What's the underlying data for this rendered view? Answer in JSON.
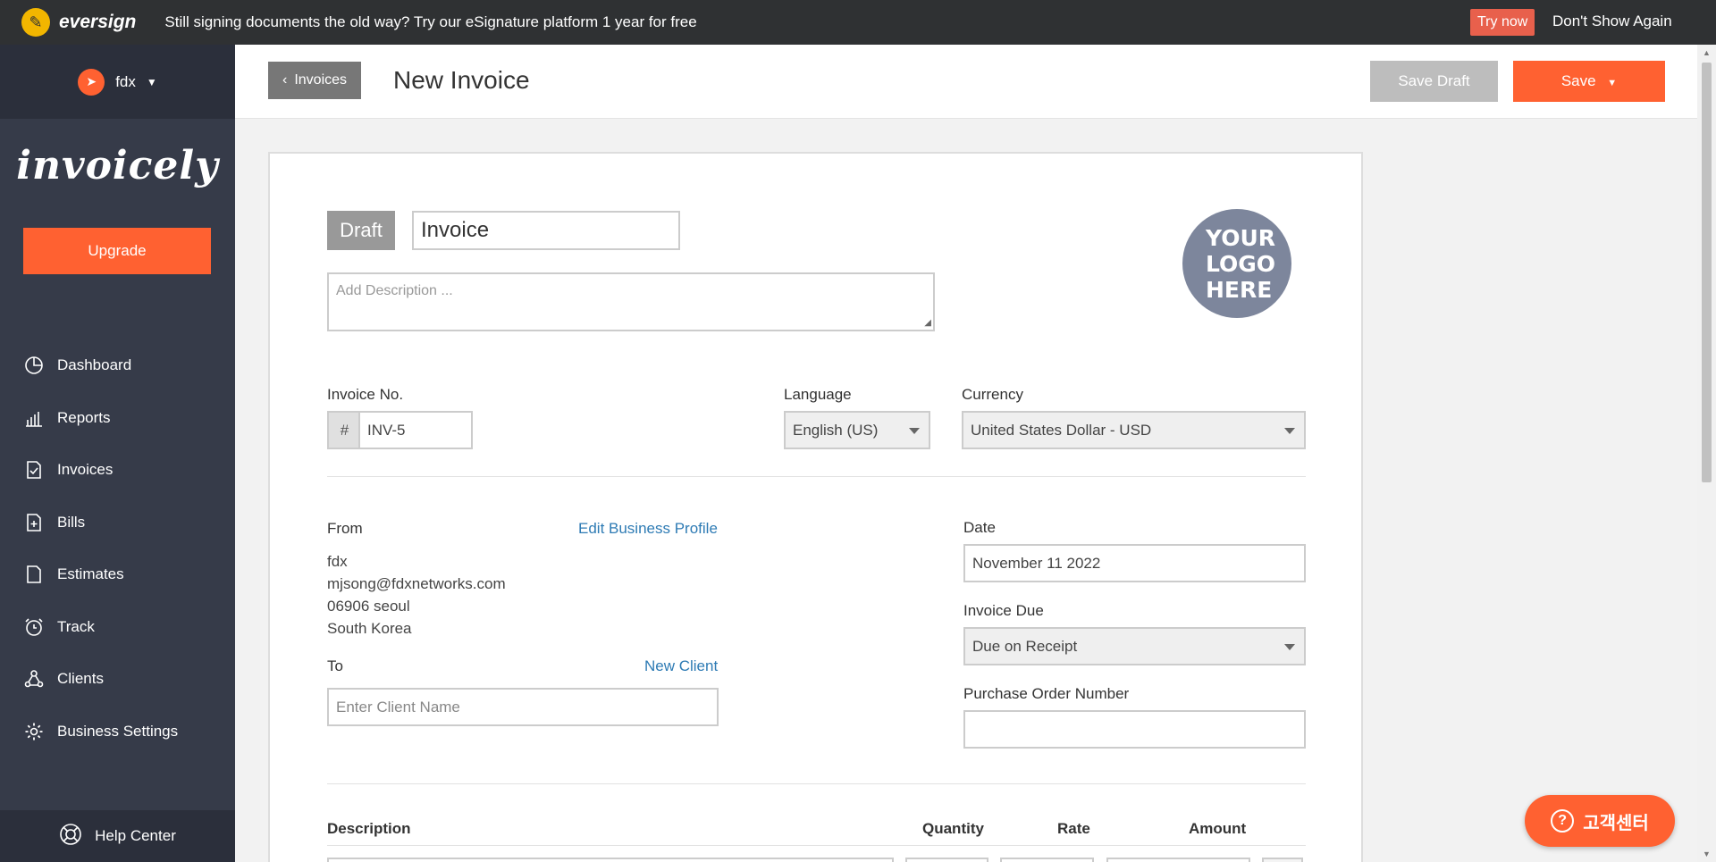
{
  "banner": {
    "brand": "eversign",
    "promo": "Still signing documents the old way? Try our eSignature platform 1 year for free",
    "try_now": "Try now",
    "dont_show": "Don't Show Again",
    "accent": "#e8604c"
  },
  "sidebar": {
    "account_name": "fdx",
    "brand": "invoicely",
    "upgrade": "Upgrade",
    "items": [
      {
        "label": "Dashboard",
        "icon": "pie-chart-icon"
      },
      {
        "label": "Reports",
        "icon": "bar-chart-icon"
      },
      {
        "label": "Invoices",
        "icon": "invoice-doc-icon"
      },
      {
        "label": "Bills",
        "icon": "bill-plus-icon"
      },
      {
        "label": "Estimates",
        "icon": "document-icon"
      },
      {
        "label": "Track",
        "icon": "alarm-clock-icon"
      },
      {
        "label": "Clients",
        "icon": "clients-icon"
      },
      {
        "label": "Business Settings",
        "icon": "gear-icon"
      }
    ],
    "help": "Help Center"
  },
  "header": {
    "back": "Invoices",
    "title": "New Invoice",
    "save_draft": "Save Draft",
    "save": "Save",
    "accent": "#ff6131"
  },
  "invoice": {
    "status": "Draft",
    "title_value": "Invoice",
    "description_placeholder": "Add Description ...",
    "logo_text": "YOUR LOGO HERE",
    "invoice_no_label": "Invoice No.",
    "hash": "#",
    "invoice_no": "INV-5",
    "language_label": "Language",
    "language": "English (US)",
    "currency_label": "Currency",
    "currency": "United States Dollar - USD",
    "from_label": "From",
    "edit_profile": "Edit Business Profile",
    "from_lines": [
      "fdx",
      "mjsong@fdxnetworks.com",
      "06906 seoul",
      "South Korea"
    ],
    "to_label": "To",
    "new_client": "New Client",
    "client_placeholder": "Enter Client Name",
    "date_label": "Date",
    "date": "November 11 2022",
    "due_label": "Invoice Due",
    "due": "Due on Receipt",
    "po_label": "Purchase Order Number",
    "po": "",
    "columns": {
      "description": "Description",
      "quantity": "Quantity",
      "rate": "Rate",
      "amount": "Amount"
    }
  },
  "support": {
    "label": "고객센터"
  }
}
